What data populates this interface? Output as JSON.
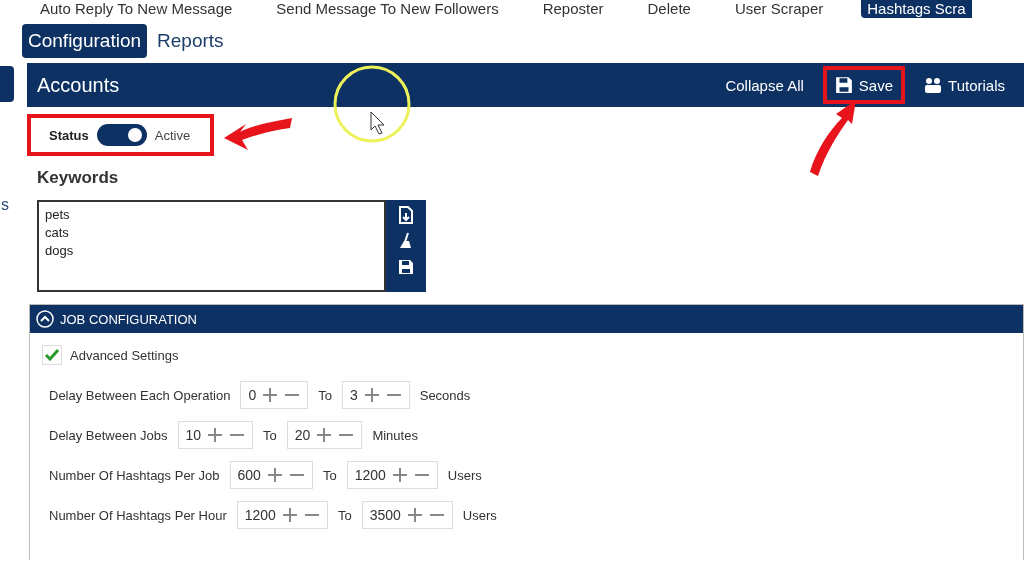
{
  "top_tabs": [
    {
      "label": "Auto Reply To New Message",
      "selected": false
    },
    {
      "label": "Send Message To New Followers",
      "selected": false
    },
    {
      "label": "Reposter",
      "selected": false
    },
    {
      "label": "Delete",
      "selected": false
    },
    {
      "label": "User Scraper",
      "selected": false
    },
    {
      "label": "Hashtags Scra",
      "selected": true
    }
  ],
  "sub_tabs": [
    {
      "label": "Configuration",
      "selected": true
    },
    {
      "label": "Reports",
      "selected": false
    }
  ],
  "sidebar_fragment": "s",
  "panel": {
    "title": "Accounts",
    "actions": [
      {
        "kind": "link",
        "label": "Collapse All",
        "highlighted": false
      },
      {
        "kind": "save",
        "label": "Save",
        "highlighted": true
      },
      {
        "kind": "tutorials",
        "label": "Tutorials",
        "highlighted": false
      }
    ]
  },
  "status": {
    "label": "Status",
    "on": true,
    "value": "Active",
    "highlighted": true
  },
  "keywords": {
    "title": "Keywords",
    "value": "pets\ncats\ndogs"
  },
  "job_configuration": {
    "title": "JOB CONFIGURATION",
    "expanded": true,
    "advanced_settings": {
      "label": "Advanced Settings",
      "checked": true
    },
    "rows": [
      {
        "label": "Delay Between Each Operation",
        "from": "0",
        "to_label": "To",
        "to": "3",
        "unit": "Seconds"
      },
      {
        "label": "Delay Between Jobs",
        "from": "10",
        "to_label": "To",
        "to": "20",
        "unit": "Minutes"
      },
      {
        "label": "Number Of Hashtags Per Job",
        "from": "600",
        "to_label": "To",
        "to": "1200",
        "unit": "Users"
      },
      {
        "label": "Number Of Hashtags Per Hour",
        "from": "1200",
        "to_label": "To",
        "to": "3500",
        "unit": "Users"
      }
    ]
  }
}
